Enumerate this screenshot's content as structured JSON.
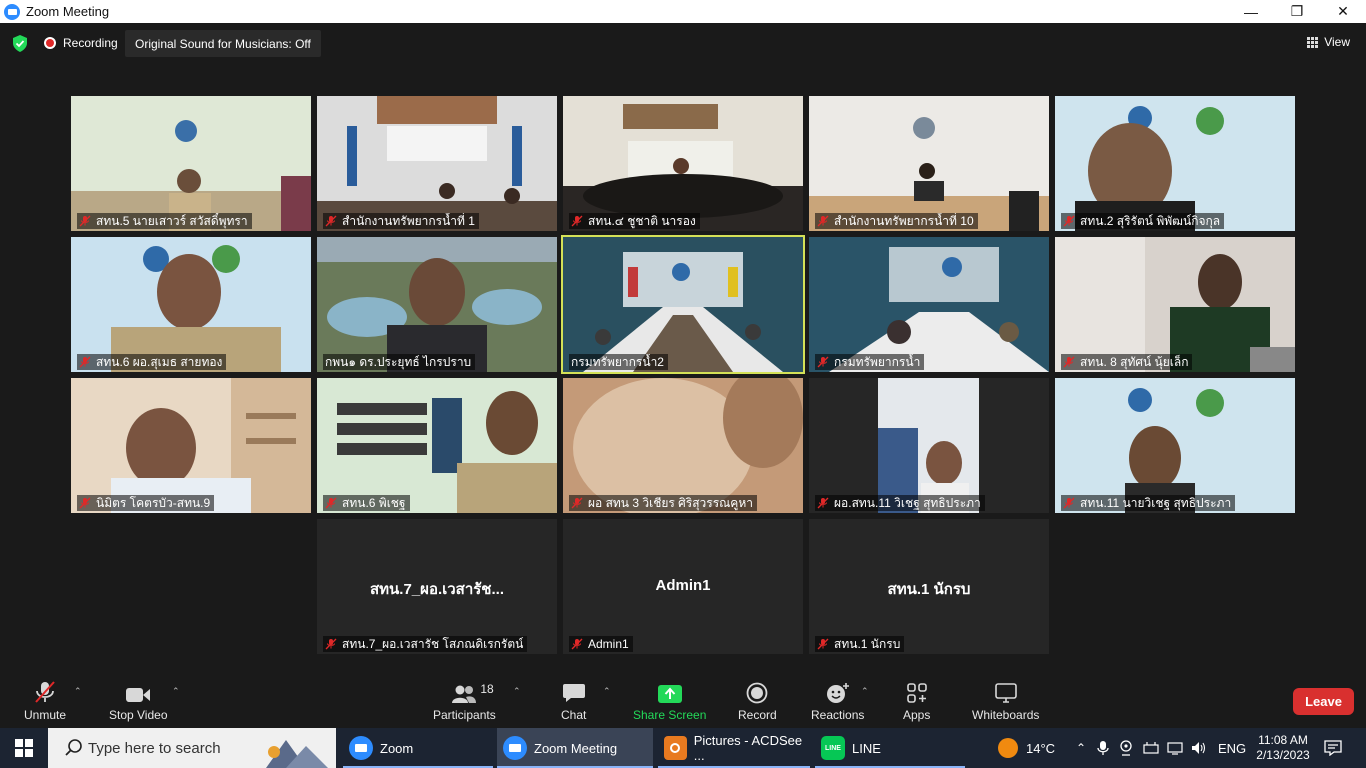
{
  "window": {
    "title": "Zoom Meeting",
    "minimize": "—",
    "maximize": "❐",
    "close": "✕"
  },
  "topbar": {
    "recording_label": "Recording",
    "original_sound": "Original Sound for Musicians: Off",
    "view_label": "View"
  },
  "participants": [
    {
      "name": "สทน.5 นายเสาวร์ สวัสดิ์พุทรา"
    },
    {
      "name": "สำนักงานทรัพยากรน้ำที่ 1"
    },
    {
      "name": "สทน.๔ ชูชาติ นารอง"
    },
    {
      "name": "สำนักงานทรัพยากรน้ำที่ 10"
    },
    {
      "name": "สทน.2 สุริรัตน์ พิพัฒน์กิจกุล"
    },
    {
      "name": "สทน.6 ผอ.สุเมธ สายทอง"
    },
    {
      "name": "กพน๑ ดร.ประยุทธ์ ไกรปราบ"
    },
    {
      "name": "กรมทรัพยากรน้ำ2"
    },
    {
      "name": "กรมทรัพยากรน้ำ"
    },
    {
      "name": "สทน. 8 สุทัศน์ นุ้ยเล็ก"
    },
    {
      "name": "นิมิตร โคตรบัว-สทน.9"
    },
    {
      "name": "สทน.6 พิเชฐ"
    },
    {
      "name": "ผอ สทน 3 วิเชียร ศิริสุวรรณคูหา"
    },
    {
      "name": "ผอ.สทน.11 วิเชฐ สุทธิประภา"
    },
    {
      "name": "สทน.11 นายวิเชฐ สุทธิประภา"
    },
    {
      "name": "สทน.7_ผอ.เวสารัช โสภณดิเรกรัตน์",
      "display": "สทน.7_ผอ.เวสารัช..."
    },
    {
      "name": "Admin1",
      "display": "Admin1"
    },
    {
      "name": "สทน.1 นักรบ",
      "display": "สทน.1 นักรบ"
    }
  ],
  "toolbar": {
    "unmute": "Unmute",
    "stop_video": "Stop Video",
    "participants": "Participants",
    "participants_count": "18",
    "chat": "Chat",
    "share_screen": "Share Screen",
    "record": "Record",
    "reactions": "Reactions",
    "apps": "Apps",
    "whiteboards": "Whiteboards",
    "leave": "Leave"
  },
  "taskbar": {
    "search_placeholder": "Type here to search",
    "apps": [
      {
        "label": "Zoom"
      },
      {
        "label": "Zoom Meeting"
      },
      {
        "label": "Pictures - ACDSee ..."
      },
      {
        "label": "LINE"
      }
    ],
    "temperature": "14°C",
    "language": "ENG",
    "time": "11:08 AM",
    "date": "2/13/2023"
  },
  "colors": {
    "active_speaker": "#d4e157",
    "leave": "#d9302f",
    "share_screen": "#23d959",
    "muted_mic": "#e02828"
  }
}
